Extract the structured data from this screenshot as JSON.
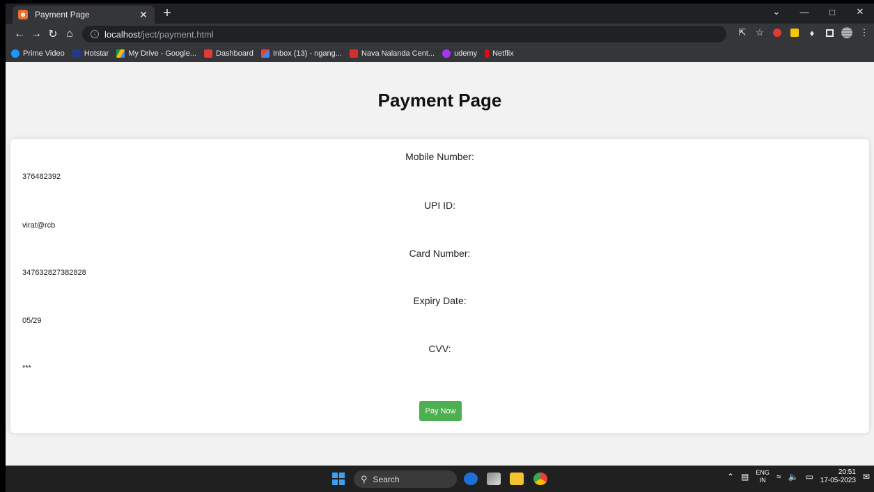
{
  "browser": {
    "tab_title": "Payment Page",
    "tab_favicon": "xampp-icon",
    "new_tab_label": "+",
    "url_host": "localhost",
    "url_path": "/ject/payment.html",
    "bookmarks": [
      {
        "label": "Prime Video",
        "icon_color": "#1a98ff"
      },
      {
        "label": "Hotstar",
        "icon_color": "#1f3b8a"
      },
      {
        "label": "My Drive - Google...",
        "icon_color": "#fbbc04"
      },
      {
        "label": "Dashboard",
        "icon_color": "#e53935"
      },
      {
        "label": "Inbox (13) - ngang...",
        "icon_color": "#ea4335"
      },
      {
        "label": "Nava Nalanda Cent...",
        "icon_color": "#d32f2f"
      },
      {
        "label": "udemy",
        "icon_color": "#a435f0"
      },
      {
        "label": "Netflix",
        "icon_color": "#e50914"
      }
    ]
  },
  "page": {
    "title": "Payment Page",
    "fields": [
      {
        "label": "Mobile Number:",
        "value": "376482392"
      },
      {
        "label": "UPI ID:",
        "value": "virat@rcb"
      },
      {
        "label": "Card Number:",
        "value": "347632827382828"
      },
      {
        "label": "Expiry Date:",
        "value": "05/29"
      },
      {
        "label": "CVV:",
        "value": "***"
      }
    ],
    "pay_button_label": "Pay Now",
    "pay_button_color": "#4caf50"
  },
  "taskbar": {
    "search_label": "Search",
    "language": "ENG",
    "region": "IN",
    "time": "20:51",
    "date": "17-05-2023"
  }
}
